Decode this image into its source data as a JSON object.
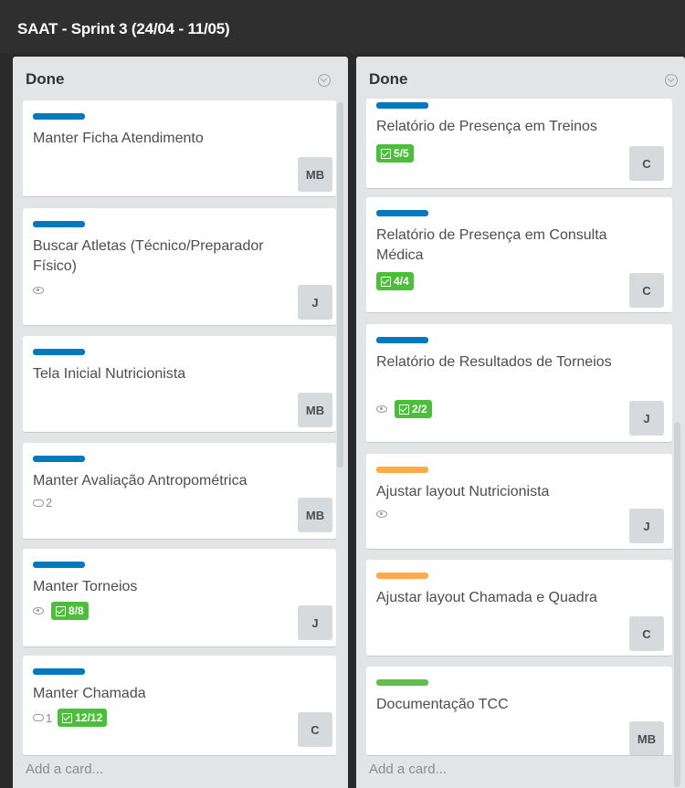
{
  "board": {
    "title": "SAAT - Sprint 3 (24/04 - 11/05)"
  },
  "colors": {
    "blue": "#0079bf",
    "orange": "#ffab4a",
    "green": "#61bd4f",
    "badge_green": "#4bbf3a"
  },
  "lists": [
    {
      "title": "Done",
      "add_card": "Add a card...",
      "cards": [
        {
          "title": "Manter Ficha Atendimento",
          "label_color": "blue",
          "member": "MB"
        },
        {
          "title": "Buscar Atletas (Técnico/Preparador Físico)",
          "label_color": "blue",
          "member": "J",
          "watching": true
        },
        {
          "title": "Tela Inicial Nutricionista",
          "label_color": "blue",
          "member": "MB"
        },
        {
          "title": "Manter Avaliação Antropométrica",
          "label_color": "blue",
          "member": "MB",
          "comments": "2"
        },
        {
          "title": "Manter Torneios",
          "label_color": "blue",
          "member": "J",
          "watching": true,
          "checklist": "8/8"
        },
        {
          "title": "Manter Chamada",
          "label_color": "blue",
          "member": "C",
          "comments": "1",
          "checklist": "12/12"
        }
      ]
    },
    {
      "title": "Done",
      "add_card": "Add a card...",
      "cards": [
        {
          "title": "Relatório de Presença em Treinos",
          "label_color": "blue",
          "member": "C",
          "checklist": "5/5"
        },
        {
          "title": "Relatório de Presença em Consulta Médica",
          "label_color": "blue",
          "member": "C",
          "checklist": "4/4"
        },
        {
          "title": "Relatório de Resultados de Torneios",
          "label_color": "blue",
          "member": "J",
          "watching": true,
          "checklist": "2/2"
        },
        {
          "title": "Ajustar layout Nutricionista",
          "label_color": "orange",
          "member": "J",
          "watching": true
        },
        {
          "title": "Ajustar layout Chamada e Quadra",
          "label_color": "orange",
          "member": "C"
        },
        {
          "title": "Documentação TCC",
          "label_color": "green",
          "member": "MB"
        }
      ]
    }
  ]
}
